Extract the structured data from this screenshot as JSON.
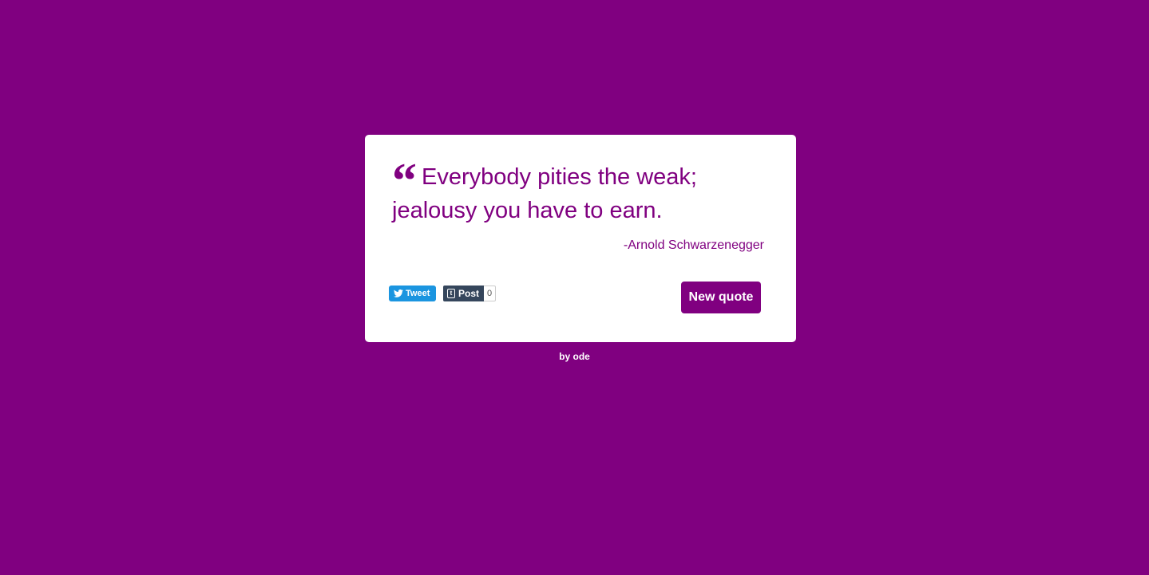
{
  "theme": {
    "background": "#800080",
    "card_background": "#ffffff",
    "text_color": "#800080"
  },
  "quote": {
    "icon": "quote-left-icon",
    "text": "Everybody pities the weak; jealousy you have to earn.",
    "author": "-Arnold Schwarzenegger"
  },
  "share": {
    "tweet": {
      "label": "Tweet",
      "icon": "twitter-bird-icon",
      "color": "#1b95e0"
    },
    "tumblr": {
      "label": "Post",
      "icon": "tumblr-icon",
      "count": "0",
      "color": "#35465c"
    }
  },
  "actions": {
    "new_quote_label": "New quote"
  },
  "footer": {
    "text": "by ode"
  }
}
